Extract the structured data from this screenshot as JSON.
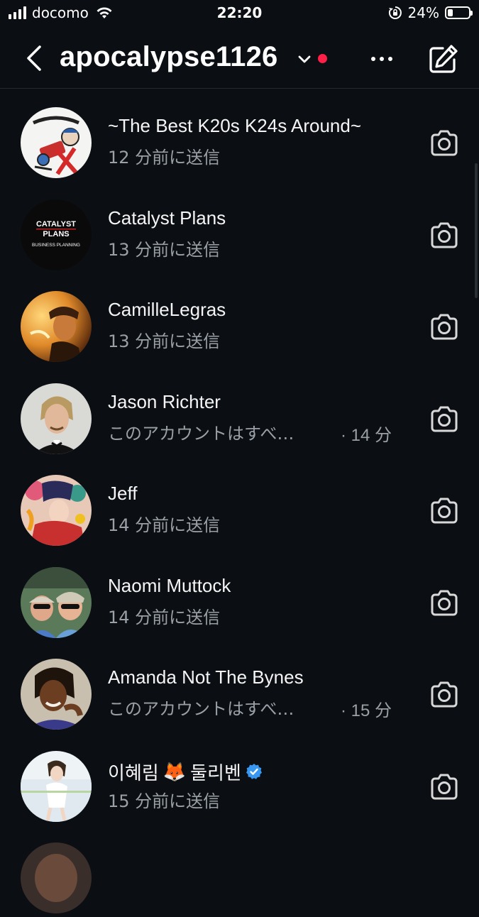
{
  "status_bar": {
    "carrier": "docomo",
    "time": "22:20",
    "battery_percent": "24%",
    "battery_level": 0.24,
    "signal_bars": 4
  },
  "header": {
    "username": "apocalypse1126",
    "back_icon": "chevron-left-icon",
    "dropdown_icon": "chevron-down-icon",
    "more_icon": "more-horizontal-icon",
    "compose_icon": "compose-icon",
    "notification_dot_color": "#ff1f47"
  },
  "messages": [
    {
      "name": "~The Best K20s K24s Around~",
      "subtitle": "12 分前に送信",
      "time": ""
    },
    {
      "name": "Catalyst Plans",
      "subtitle": "13 分前に送信",
      "time": "",
      "avatar_text": {
        "line1": "CATALYST",
        "line2": "PLANS",
        "line3": "BUSINESS PLANNING"
      }
    },
    {
      "name": "CamilleLegras",
      "subtitle": "13 分前に送信",
      "time": ""
    },
    {
      "name": "Jason Richter",
      "subtitle": "このアカウントはすべ…",
      "time": "· 14 分"
    },
    {
      "name": "Jeff",
      "subtitle": "14 分前に送信",
      "time": ""
    },
    {
      "name": "Naomi Muttock",
      "subtitle": "14 分前に送信",
      "time": ""
    },
    {
      "name": "Amanda Not The Bynes",
      "subtitle": "このアカウントはすべ…",
      "time": "· 15 分"
    },
    {
      "name": "이혜림",
      "name_emoji": "🦊",
      "name_suffix": "둘리벤",
      "verified": true,
      "subtitle": "15 分前に送信",
      "time": ""
    }
  ],
  "colors": {
    "background": "#0b0f14",
    "secondary_text": "#9aa0a6",
    "verified_badge": "#3897f0"
  }
}
